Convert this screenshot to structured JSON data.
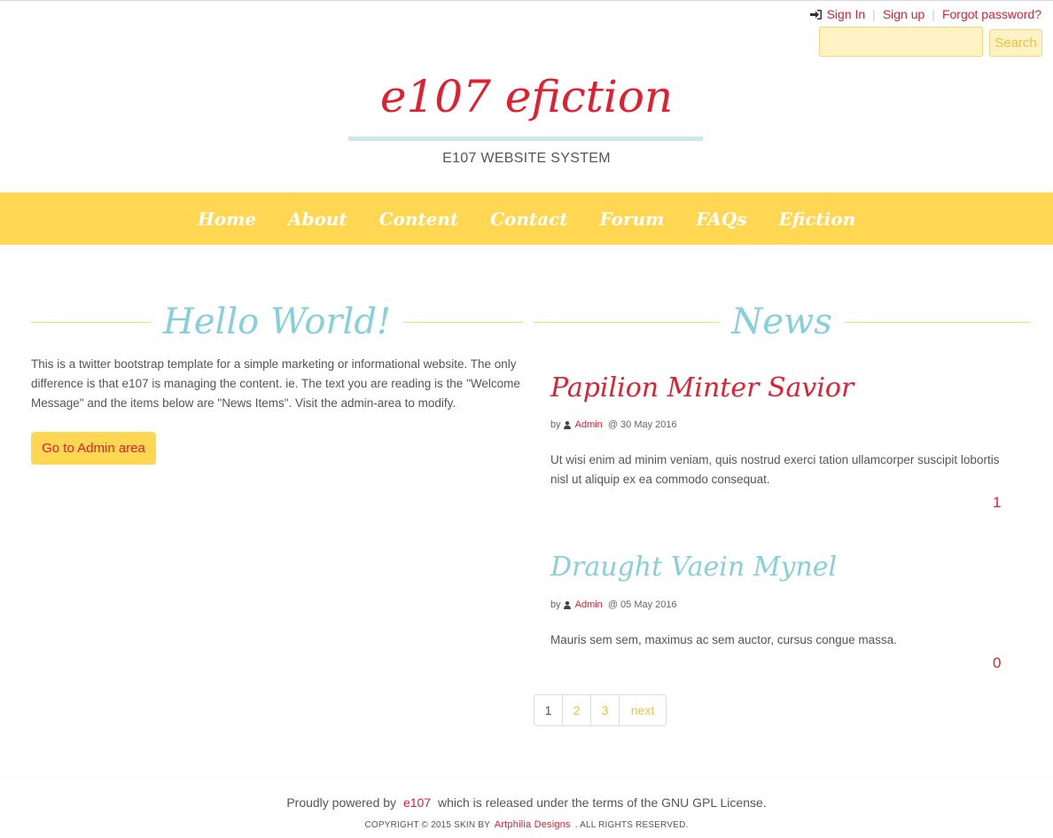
{
  "top_links": {
    "sign_in": "Sign In",
    "sign_up": "Sign up",
    "forgot": "Forgot password?",
    "separator": "|",
    "sign_in_icon": "sign-in-icon"
  },
  "search": {
    "placeholder": "",
    "value": "",
    "button": "Search"
  },
  "brand": {
    "title": "e107 efiction",
    "tagline": "E107 WEBSITE SYSTEM"
  },
  "nav": {
    "items": [
      "Home",
      "About",
      "Content",
      "Contact",
      "Forum",
      "FAQs",
      "Efiction"
    ]
  },
  "welcome": {
    "heading": "Hello World!",
    "text": "This is a twitter bootstrap template for a simple marketing or informational website. The only difference is that e107 is managing the content. ie. The text you are reading is the \"Welcome Message\" and the items below are \"News Items\". Visit the admin-area to modify.",
    "button": "Go to Admin area"
  },
  "news": {
    "heading": "News",
    "items": [
      {
        "title": "Papilion Minter Savior",
        "by": "by",
        "author": "Admin",
        "date": "@ 30 May 2016",
        "body": "Ut wisi enim ad minim veniam, quis nostrud exerci tation ullamcorper suscipit lobortis nisl ut aliquip ex ea commodo consequat.",
        "comments": "1"
      },
      {
        "title": "Draught Vaein Mynel",
        "by": "by",
        "author": "Admin",
        "date": "@ 05 May 2016",
        "body": "Mauris sem sem, maximus ac sem auctor, cursus congue massa.",
        "comments": "0"
      }
    ]
  },
  "pagination": {
    "pages": [
      "1",
      "2",
      "3"
    ],
    "next": "next",
    "current": "1"
  },
  "footer": {
    "line1_pre": "Proudly powered by",
    "line1_link": "e107",
    "line1_post": "which is released under the terms of the GNU GPL License.",
    "line2_pre": "COPYRIGHT © 2015 SKIN BY",
    "line2_link": "Artphilia Designs",
    "line2_post": ". ALL RIGHTS RESERVED."
  },
  "colors": {
    "accent_red": "#e02030",
    "nav_yellow": "#ffd753",
    "heading_blue": "#86cfdc"
  }
}
